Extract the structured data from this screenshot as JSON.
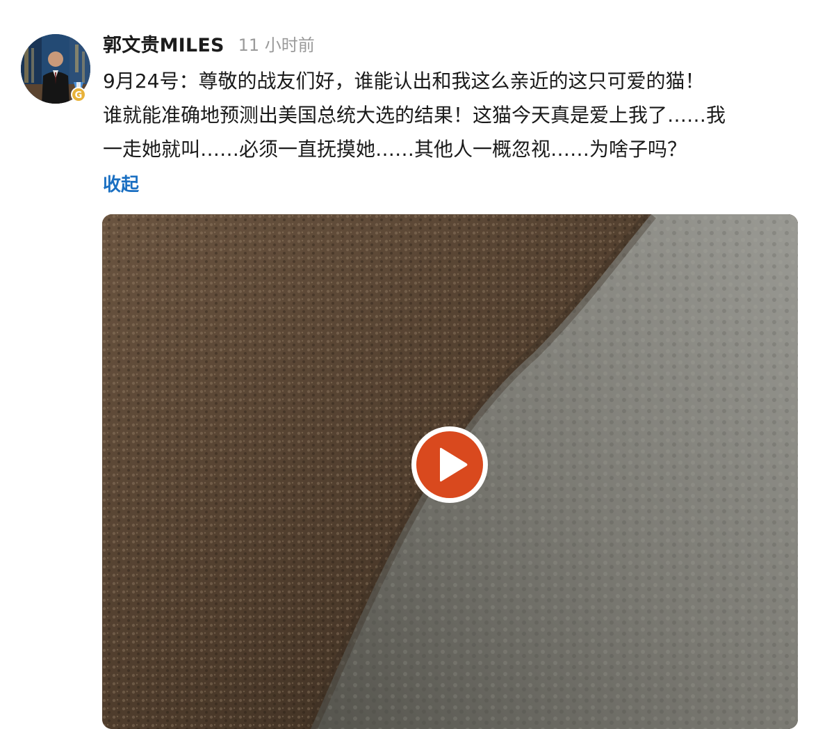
{
  "post": {
    "author": "郭文贵MILES",
    "timestamp": "11 小时前",
    "body_lines": [
      "9月24号：尊敬的战友们好，谁能认出和我这么亲近的这只可爱的猫！",
      "谁就能准确地预测出美国总统大选的结果！这猫今天真是爱上我了……我",
      "一走她就叫……必须一直抚摸她……其他人一概忽视……为啥子吗？"
    ],
    "collapse_label": "收起",
    "badge_letter": "G"
  },
  "icons": {
    "avatar": "user-avatar-photo",
    "badge": "verified-medal-icon",
    "play": "play-icon"
  },
  "colors": {
    "author": "#1c1c1c",
    "timestamp": "#9a9a9a",
    "link": "#1a6fc2",
    "play_button": "#d9491e",
    "badge_gold": "#e8b23a",
    "badge_ribbon": "#4a8fd6"
  }
}
